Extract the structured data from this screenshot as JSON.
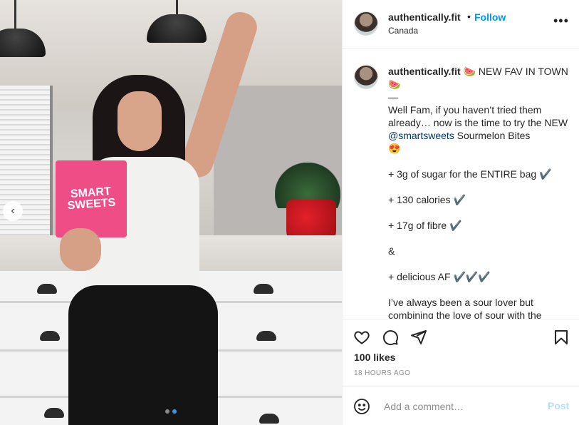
{
  "post": {
    "username": "authentically.fit",
    "separator": "•",
    "follow_label": "Follow",
    "location": "Canada",
    "more_icon": "•••",
    "photo": {
      "bag_text": "SMART SWEETS",
      "nav_prev_icon": "‹",
      "carousel_dots": 2,
      "active_dot": 1
    },
    "caption": {
      "username": "authentically.fit",
      "first_line": " NEW FAV IN TOWN",
      "emoji_watermelon": "🍉",
      "dash": "—",
      "body_1": "Well Fam, if you haven’t tried them already… now is the time to try the NEW ",
      "mention": "@smartsweets",
      "body_2": " Sourmelon Bites",
      "emoji_heart_eyes": "😍",
      "point_1": "+ 3g of sugar for the ENTIRE bag ✔️",
      "point_2": "+ 130 calories ✔️",
      "point_3": "+ 17g of fibre ✔️",
      "amp": "&",
      "point_4": "+ delicious AF ✔️✔️✔️",
      "body_3": "I’ve always been a sour lover but combining the love of sour with the"
    },
    "likes_text": "100 likes",
    "time_text": "18 HOURS AGO",
    "comment": {
      "placeholder": "Add a comment…",
      "post_label": "Post"
    },
    "icons": {
      "like": "heart-icon",
      "comment": "comment-icon",
      "share": "share-icon",
      "save": "bookmark-icon",
      "emoji": "smiley-icon"
    },
    "colors": {
      "follow": "#0095f6",
      "post_disabled": "#b2dffc",
      "text": "#262626",
      "muted": "#8e8e8e",
      "mention": "#00376b"
    }
  }
}
